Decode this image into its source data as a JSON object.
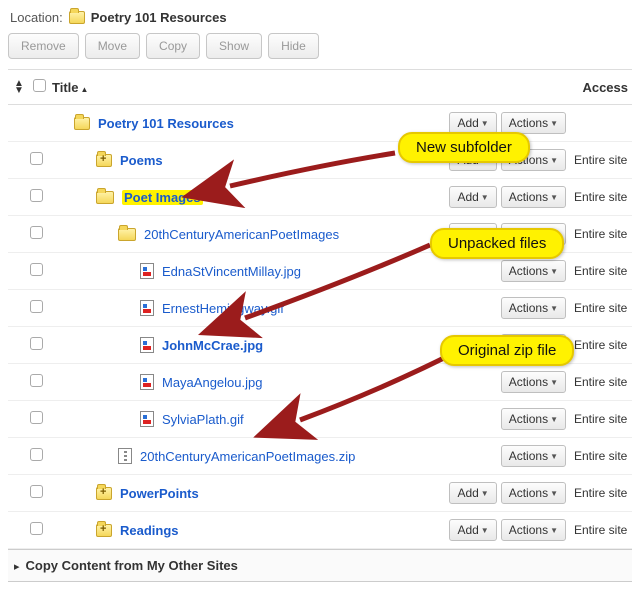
{
  "location": {
    "label": "Location:",
    "folder_name": "Poetry 101 Resources"
  },
  "toolbar": {
    "remove": "Remove",
    "move": "Move",
    "copy": "Copy",
    "show": "Show",
    "hide": "Hide"
  },
  "columns": {
    "title": "Title",
    "access": "Access"
  },
  "buttons": {
    "add": "Add",
    "actions": "Actions"
  },
  "access_value": "Entire site",
  "rows": [
    {
      "indent": 0,
      "icon": "folder",
      "name": "Poetry 101 Resources",
      "bold": true,
      "checkbox": false,
      "add": true,
      "actions": true,
      "access": false,
      "highlight": false
    },
    {
      "indent": 1,
      "icon": "folder-plus",
      "name": "Poems",
      "bold": true,
      "checkbox": true,
      "add": true,
      "actions": true,
      "access": true,
      "highlight": false
    },
    {
      "indent": 1,
      "icon": "folder-open",
      "name": "Poet Images",
      "bold": true,
      "checkbox": true,
      "add": true,
      "actions": true,
      "access": true,
      "highlight": true
    },
    {
      "indent": 2,
      "icon": "folder-open",
      "name": "20thCenturyAmericanPoetImages",
      "bold": false,
      "checkbox": true,
      "add": true,
      "actions": true,
      "access": true,
      "highlight": false
    },
    {
      "indent": 3,
      "icon": "image",
      "name": "EdnaStVincentMillay.jpg",
      "bold": false,
      "checkbox": true,
      "add": false,
      "actions": true,
      "access": true,
      "highlight": false
    },
    {
      "indent": 3,
      "icon": "image",
      "name": "ErnestHemingway.gif",
      "bold": false,
      "checkbox": true,
      "add": false,
      "actions": true,
      "access": true,
      "highlight": false
    },
    {
      "indent": 3,
      "icon": "image",
      "name": "JohnMcCrae.jpg",
      "bold": true,
      "checkbox": true,
      "add": false,
      "actions": true,
      "access": true,
      "highlight": false
    },
    {
      "indent": 3,
      "icon": "image",
      "name": "MayaAngelou.jpg",
      "bold": false,
      "checkbox": true,
      "add": false,
      "actions": true,
      "access": true,
      "highlight": false
    },
    {
      "indent": 3,
      "icon": "image",
      "name": "SylviaPlath.gif",
      "bold": false,
      "checkbox": true,
      "add": false,
      "actions": true,
      "access": true,
      "highlight": false
    },
    {
      "indent": 2,
      "icon": "zip",
      "name": "20thCenturyAmericanPoetImages.zip",
      "bold": false,
      "checkbox": true,
      "add": false,
      "actions": true,
      "access": true,
      "highlight": false
    },
    {
      "indent": 1,
      "icon": "folder-plus",
      "name": "PowerPoints",
      "bold": true,
      "checkbox": true,
      "add": true,
      "actions": true,
      "access": true,
      "highlight": false
    },
    {
      "indent": 1,
      "icon": "folder-plus",
      "name": "Readings",
      "bold": true,
      "checkbox": true,
      "add": true,
      "actions": true,
      "access": true,
      "highlight": false
    }
  ],
  "footer": {
    "text": "Copy Content from My Other Sites"
  },
  "annotations": {
    "new_subfolder": "New subfolder",
    "unpacked": "Unpacked files",
    "original_zip": "Original zip file"
  }
}
